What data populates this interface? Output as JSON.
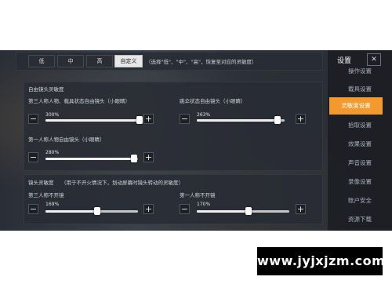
{
  "sensitivity_mode": {
    "options": [
      "低",
      "中",
      "高",
      "自定义"
    ],
    "selected": "自定义",
    "hint": "（选择\"低\"、\"中\"、\"高\"，恢复至对应的灵敏度）"
  },
  "free_camera": {
    "title": "自由镜头灵敏度",
    "sliders": [
      {
        "label": "第三人称人物、载具状态自由镜头（小眼睛）",
        "value_text": "300%",
        "fraction": 0.98
      },
      {
        "label": "跳伞状态自由镜头（小眼睛）",
        "value_text": "263%",
        "fraction": 0.92
      },
      {
        "label": "第一人称人物自由镜头（小眼睛）",
        "value_text": "280%",
        "fraction": 0.96
      }
    ]
  },
  "camera": {
    "title": "镜头灵敏度",
    "subtitle": "（用于不开火情况下，划动屏幕时镜头转动的灵敏度）",
    "sliders": [
      {
        "label": "第三人称不开镜",
        "value_text": "169%",
        "fraction": 0.56
      },
      {
        "label": "第一人称不开镜",
        "value_text": "170%",
        "fraction": 0.56
      }
    ]
  },
  "buttons": {
    "minus": "−",
    "plus": "+"
  },
  "sidebar": {
    "title": "设置",
    "close": "✕",
    "items": [
      {
        "label": "操作设置",
        "active": false
      },
      {
        "label": "载具设置",
        "active": false
      },
      {
        "label": "灵敏度设置",
        "active": true
      },
      {
        "label": "拾取设置",
        "active": false
      },
      {
        "label": "效果设置",
        "active": false
      },
      {
        "label": "声音设置",
        "active": false
      },
      {
        "label": "录像设置",
        "active": false
      },
      {
        "label": "账户安全",
        "active": false
      },
      {
        "label": "资源下载",
        "active": false
      }
    ]
  },
  "colors": {
    "accent": "#f29a2e"
  },
  "watermark": "www.jyjxjzm.com"
}
